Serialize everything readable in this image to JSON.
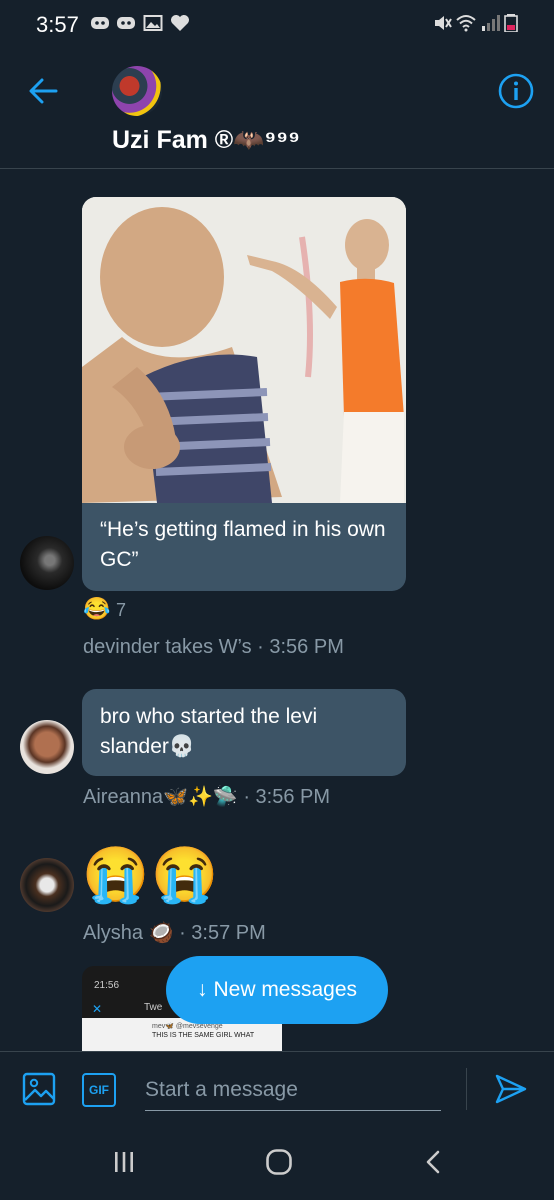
{
  "status_bar": {
    "time": "3:57"
  },
  "header": {
    "title": "Uzi Fam ®🦇⁹⁹⁹"
  },
  "messages": [
    {
      "text": "“He’s getting flamed in his own GC”",
      "reaction": "😂",
      "reaction_count": "7",
      "sender": "devinder takes W’s",
      "time": "· 3:56 PM"
    },
    {
      "text": "bro who started the levi slander💀",
      "sender": "Aireanna🦋✨🛸",
      "time": "· 3:56 PM"
    },
    {
      "text": "😭😭",
      "sender": "Alysha 🥥",
      "time": "· 3:57 PM"
    },
    {
      "preview_time": "21:56",
      "preview_tab": "Twe",
      "preview_handle": "mev🦋 @mevsevenge",
      "preview_text": "THIS IS THE SAME GIRL WHAT"
    }
  ],
  "new_messages": {
    "arrow": "↓",
    "label": "New messages"
  },
  "composer": {
    "placeholder": "Start a message",
    "gif_label": "GIF"
  },
  "colors": {
    "background": "#15202b",
    "accent": "#1da1f2",
    "bubble": "#3d5466",
    "muted": "#8899a6"
  }
}
